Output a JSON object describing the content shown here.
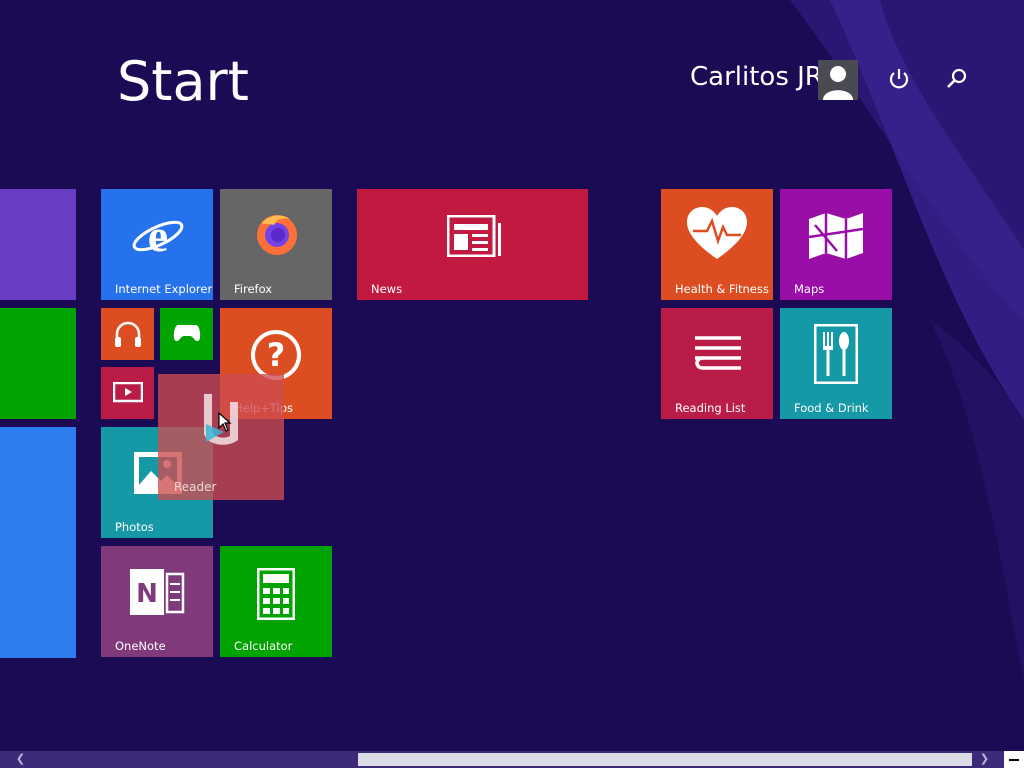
{
  "header": {
    "title": "Start",
    "user_name": "Carlitos JR"
  },
  "tiles": {
    "internet_explorer": "Internet Explorer",
    "firefox": "Firefox",
    "news": "News",
    "help_tips": "Help+Tips",
    "photos": "Photos",
    "onenote": "OneNote",
    "calculator": "Calculator",
    "health_fitness": "Health & Fitness",
    "maps": "Maps",
    "reading_list": "Reading List",
    "food_drink": "Food & Drink"
  },
  "dragging_tile": {
    "label": "Reader"
  },
  "colors": {
    "background": "#1b0a54",
    "ie": "#2672ec",
    "firefox": "#666666",
    "news": "#c1193f",
    "help": "#dc4e22",
    "music": "#dc4e22",
    "xbox": "#00a300",
    "video": "#b91d47",
    "photos": "#1599a6",
    "onenote": "#80397b",
    "calculator": "#00a300",
    "health": "#dc4e22",
    "maps": "#9a0ea8",
    "reading_list": "#b91d47",
    "food": "#1599a6"
  },
  "icons": {
    "power": "power-icon",
    "search": "search-icon",
    "avatar": "user-avatar-icon"
  }
}
